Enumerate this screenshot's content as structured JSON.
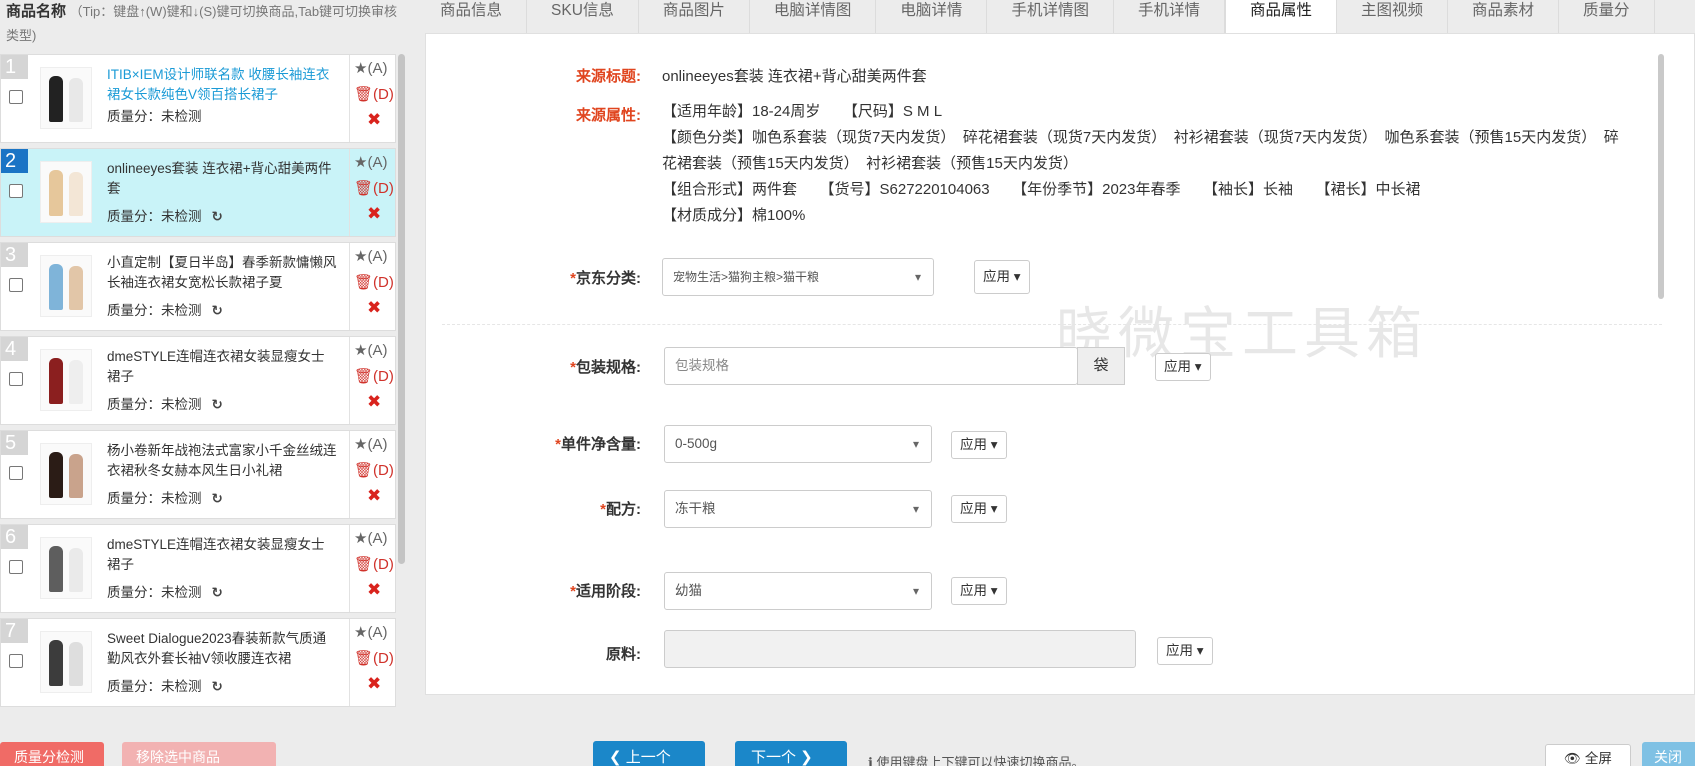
{
  "left_panel": {
    "header_title": "商品名称",
    "header_tip": "（Tip：键盘↑(W)键和↓(S)键可切换商品,Tab键可切换审核类型)",
    "items": [
      {
        "index": "1",
        "title": "ITIB×IEM设计师联名款 收腰长袖连衣裙女长款纯色V领百搭长裙子",
        "score": "质量分：未检测",
        "star": "★(A)",
        "del": "🗑(D)",
        "x": "✖"
      },
      {
        "index": "2",
        "title": "onlineeyes套装 连衣裙+背心甜美两件套",
        "score": "质量分：未检测",
        "star": "★(A)",
        "del": "🗑(D)",
        "x": "✖"
      },
      {
        "index": "3",
        "title": "小直定制【夏日半岛】春季新款慵懒风长袖连衣裙女宽松长款裙子夏",
        "score": "质量分：未检测",
        "star": "★(A)",
        "del": "🗑(D)",
        "x": "✖"
      },
      {
        "index": "4",
        "title": "dmeSTYLE连帽连衣裙女装显瘦女士裙子",
        "score": "质量分：未检测",
        "star": "★(A)",
        "del": "🗑(D)",
        "x": "✖"
      },
      {
        "index": "5",
        "title": "杨小卷新年战袍法式富家小千金丝绒连衣裙秋冬女赫本风生日小礼裙",
        "score": "质量分：未检测",
        "star": "★(A)",
        "del": "🗑(D)",
        "x": "✖"
      },
      {
        "index": "6",
        "title": "dmeSTYLE连帽连衣裙女装显瘦女士裙子",
        "score": "质量分：未检测",
        "star": "★(A)",
        "del": "🗑(D)",
        "x": "✖"
      },
      {
        "index": "7",
        "title": "Sweet Dialogue2023春装新款气质通勤风衣外套长袖V领收腰连衣裙",
        "score": "质量分：未检测",
        "star": "★(A)",
        "del": "🗑(D)",
        "x": "✖"
      }
    ],
    "sync_icon": "↻",
    "btn_quality_check": "质量分检测",
    "btn_remove_selected": "移除选中商品"
  },
  "tabs": [
    "商品信息",
    "SKU信息",
    "商品图片",
    "电脑详情图",
    "电脑详情",
    "手机详情图",
    "手机详情",
    "商品属性",
    "主图视频",
    "商品素材",
    "质量分"
  ],
  "active_tab": "商品属性",
  "content": {
    "source_title_label": "来源标题:",
    "source_title_value": "onlineeyes套装 连衣裙+背心甜美两件套",
    "source_attr_label": "来源属性:",
    "source_attr_lines": [
      "【适用年龄】18-24周岁　　【尺码】S M L",
      "【颜色分类】咖色系套装（现货7天内发货）　碎花裙套装（现货7天内发货）　衬衫裙套装（现货7天内发货）　咖色系套装（预售15天内发货）　碎花裙套装（预售15天内发货）　衬衫裙套装（预售15天内发货）",
      "【组合形式】两件套　　【货号】S627220104063　　【年份季节】2023年春季　　【袖长】长袖　　【裙长】中长裙",
      "【材质成分】棉100%"
    ],
    "jd_category_label": "京东分类:",
    "jd_category_value": "宠物生活>猫狗主粮>猫干粮",
    "package_label": "包装规格:",
    "package_placeholder": "包装规格",
    "package_unit": "袋",
    "net_weight_label": "单件净含量:",
    "net_weight_value": "0-500g",
    "formula_label": "配方:",
    "formula_value": "冻干粮",
    "stage_label": "适用阶段:",
    "stage_value": "幼猫",
    "material_label": "原料:",
    "material_value": "",
    "apply_label": "应用 ▾",
    "required_mark": "*",
    "watermark": "晓微宝工具箱"
  },
  "footer": {
    "prev_label": "❮ 上一个",
    "next_label": "下一个 ❯",
    "tip": "ℹ 使用键盘上下键可以快速切换商品。",
    "fullscreen_label": "👁 全屏",
    "close_label": "关闭"
  },
  "colors": {
    "accent": "#1b87c9",
    "selected_row": "#c9f3f8",
    "label_red": "#e0451f",
    "delete_red": "#d9231d",
    "remove_btn": "#f2b2b2"
  }
}
